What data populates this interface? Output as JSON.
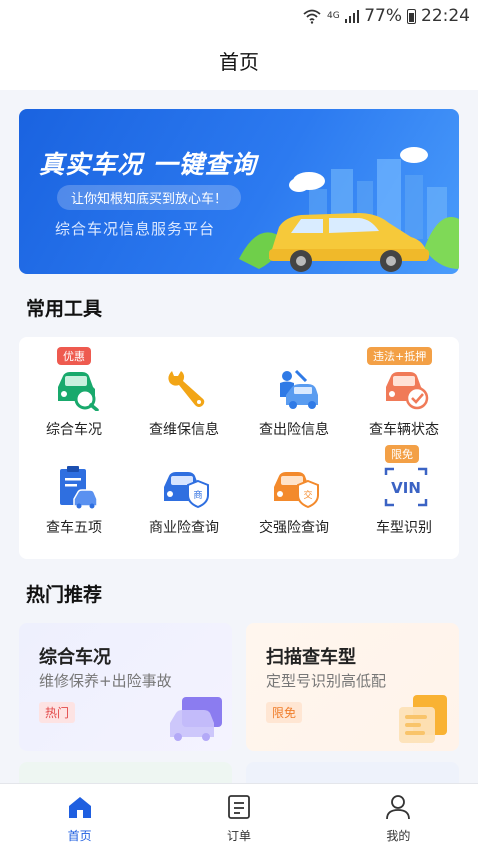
{
  "status_bar": {
    "network": "4G",
    "battery": "77%",
    "time": "22:24"
  },
  "header": {
    "title": "首页"
  },
  "banner": {
    "title": "真实车况 一键查询",
    "pill": "让你知根知底买到放心车！",
    "subtitle": "综合车况信息服务平台"
  },
  "tools": {
    "section_title": "常用工具",
    "items": [
      {
        "label": "综合车况",
        "icon": "car-search-icon",
        "badge": "优惠",
        "color": "#19a96c"
      },
      {
        "label": "查维保信息",
        "icon": "wrench-icon",
        "badge": "",
        "color": "#f2a516"
      },
      {
        "label": "查出险信息",
        "icon": "car-accident-icon",
        "badge": "",
        "color": "#2f7ae6"
      },
      {
        "label": "查车辆状态",
        "icon": "car-check-icon",
        "badge": "违法+抵押",
        "color": "#f07a58"
      },
      {
        "label": "查车五项",
        "icon": "clipboard-car-icon",
        "badge": "",
        "color": "#2f6fe0"
      },
      {
        "label": "商业险查询",
        "icon": "car-shield-commercial-icon",
        "badge": "",
        "color": "#2f6fe0"
      },
      {
        "label": "交强险查询",
        "icon": "car-shield-compulsory-icon",
        "badge": "",
        "color": "#f38a2c"
      },
      {
        "label": "车型识别",
        "icon": "vin-scan-icon",
        "badge": "限免",
        "color": "#3b63c4"
      }
    ]
  },
  "recommend": {
    "section_title": "热门推荐",
    "cards": [
      {
        "title": "综合车况",
        "subtitle": "维修保养+出险事故",
        "tag": "热门",
        "icon": "car-illustration-icon"
      },
      {
        "title": "扫描查车型",
        "subtitle": "定型号识别高低配",
        "tag": "限免",
        "icon": "scan-document-icon"
      }
    ]
  },
  "bottom_nav": {
    "items": [
      {
        "label": "首页",
        "icon": "home-icon",
        "active": true
      },
      {
        "label": "订单",
        "icon": "order-icon",
        "active": false
      },
      {
        "label": "我的",
        "icon": "user-icon",
        "active": false
      }
    ]
  },
  "colors": {
    "accent": "#1f5fe0",
    "banner": "#2c7af0",
    "badge_red": "#ee5a4f",
    "badge_orange": "#f3a046"
  }
}
